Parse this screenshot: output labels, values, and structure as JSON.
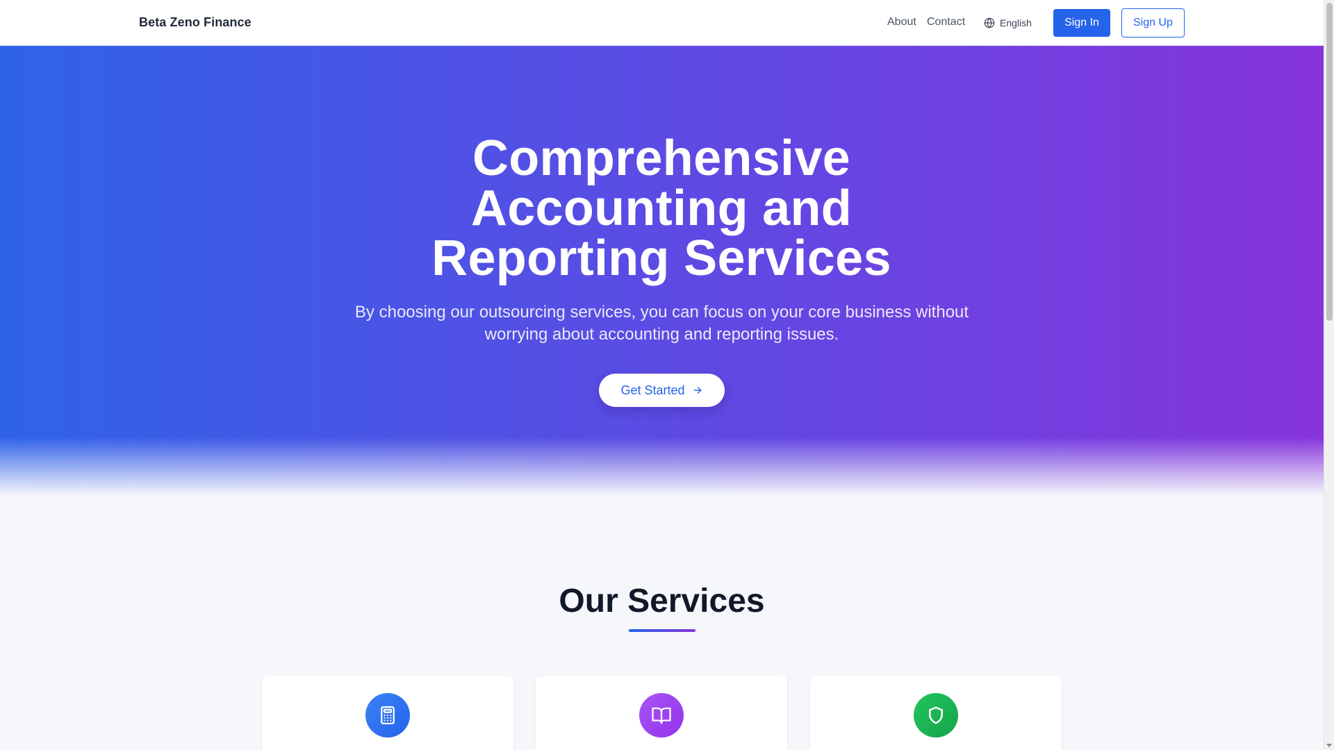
{
  "header": {
    "brand": "Beta Zeno Finance",
    "nav": {
      "about": "About",
      "contact": "Contact"
    },
    "language": {
      "label": "English",
      "icon": "globe-icon"
    },
    "sign_in": "Sign In",
    "sign_up": "Sign Up"
  },
  "hero": {
    "title": "Comprehensive Accounting and Reporting Services",
    "subtitle": "By choosing our outsourcing services, you can focus on your core business without worrying about accounting and reporting issues.",
    "cta": {
      "label": "Get Started",
      "icon": "arrow-right-icon"
    }
  },
  "services": {
    "title": "Our Services",
    "cards": [
      {
        "icon": "calculator-icon",
        "color": "#2563eb"
      },
      {
        "icon": "book-open-icon",
        "color": "#9333ea"
      },
      {
        "icon": "shield-icon",
        "color": "#16a34a"
      }
    ]
  },
  "colors": {
    "primary": "#2563eb",
    "hero_start": "#2f63e7",
    "hero_end": "#8634dc",
    "text_dark": "#111827"
  }
}
